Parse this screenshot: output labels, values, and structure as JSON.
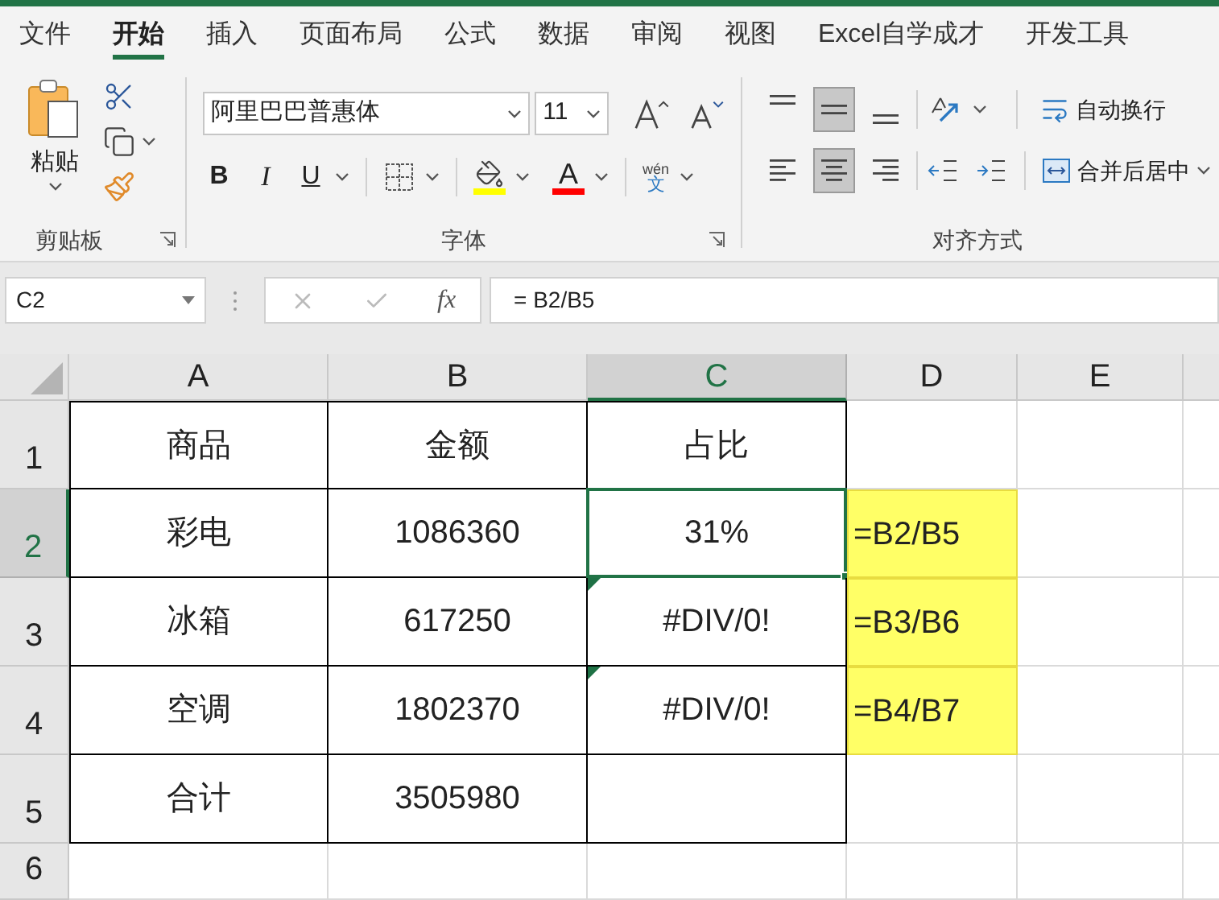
{
  "menu_tabs": [
    {
      "label": "文件",
      "selected": false
    },
    {
      "label": "开始",
      "selected": true
    },
    {
      "label": "插入",
      "selected": false
    },
    {
      "label": "页面布局",
      "selected": false
    },
    {
      "label": "公式",
      "selected": false
    },
    {
      "label": "数据",
      "selected": false
    },
    {
      "label": "审阅",
      "selected": false
    },
    {
      "label": "视图",
      "selected": false
    },
    {
      "label": "Excel自学成才",
      "selected": false
    },
    {
      "label": "开发工具",
      "selected": false
    }
  ],
  "clipboard": {
    "paste_label": "粘贴",
    "group_label": "剪贴板"
  },
  "font": {
    "name": "阿里巴巴普惠体",
    "size": "11",
    "bold": "B",
    "italic": "I",
    "underline": "U",
    "font_color_glyph": "A",
    "phonetic_top": "wén",
    "phonetic_bottom": "文",
    "group_label": "字体"
  },
  "alignment": {
    "vertical": [
      {
        "selected": false
      },
      {
        "selected": true
      },
      {
        "selected": false
      }
    ],
    "horizontal": [
      {
        "selected": false
      },
      {
        "selected": true
      },
      {
        "selected": false
      }
    ],
    "wrap_text": "自动换行",
    "merge_center": "合并后居中",
    "group_label": "对齐方式"
  },
  "formula_bar": {
    "name_box": "C2",
    "fx": "fx",
    "formula": "= B2/B5"
  },
  "columns": [
    {
      "label": "A",
      "selected": false
    },
    {
      "label": "B",
      "selected": false
    },
    {
      "label": "C",
      "selected": true
    },
    {
      "label": "D",
      "selected": false
    },
    {
      "label": "E",
      "selected": false
    }
  ],
  "rows": [
    {
      "label": "1",
      "selected": false,
      "cells": [
        {
          "kind": "table",
          "text": "商品",
          "active": false,
          "error_flag": false
        },
        {
          "kind": "table",
          "text": "金额",
          "active": false,
          "error_flag": false
        },
        {
          "kind": "table",
          "text": "占比",
          "active": false,
          "error_flag": false
        },
        {
          "kind": "plain",
          "active": false,
          "error_flag": false
        },
        {
          "kind": "plain",
          "active": false,
          "error_flag": false
        }
      ]
    },
    {
      "label": "2",
      "selected": true,
      "cells": [
        {
          "kind": "table",
          "text": "彩电",
          "active": false,
          "error_flag": false
        },
        {
          "kind": "table",
          "text": "1086360",
          "active": false,
          "error_flag": false
        },
        {
          "kind": "table",
          "text": "31%",
          "active": true,
          "error_flag": false
        },
        {
          "kind": "highlight",
          "text": "=B2/B5",
          "active": false,
          "error_flag": false
        },
        {
          "kind": "plain",
          "active": false,
          "error_flag": false
        }
      ]
    },
    {
      "label": "3",
      "selected": false,
      "cells": [
        {
          "kind": "table",
          "text": "冰箱",
          "active": false,
          "error_flag": false
        },
        {
          "kind": "table",
          "text": "617250",
          "active": false,
          "error_flag": false
        },
        {
          "kind": "table",
          "text": "#DIV/0!",
          "active": false,
          "error_flag": true
        },
        {
          "kind": "highlight",
          "text": "=B3/B6",
          "active": false,
          "error_flag": false
        },
        {
          "kind": "plain",
          "active": false,
          "error_flag": false
        }
      ]
    },
    {
      "label": "4",
      "selected": false,
      "cells": [
        {
          "kind": "table",
          "text": "空调",
          "active": false,
          "error_flag": false
        },
        {
          "kind": "table",
          "text": "1802370",
          "active": false,
          "error_flag": false
        },
        {
          "kind": "table",
          "text": "#DIV/0!",
          "active": false,
          "error_flag": true
        },
        {
          "kind": "highlight",
          "text": "=B4/B7",
          "active": false,
          "error_flag": false
        },
        {
          "kind": "plain",
          "active": false,
          "error_flag": false
        }
      ]
    },
    {
      "label": "5",
      "selected": false,
      "cells": [
        {
          "kind": "table",
          "text": "合计",
          "active": false,
          "error_flag": false
        },
        {
          "kind": "table",
          "text": "3505980",
          "active": false,
          "error_flag": false
        },
        {
          "kind": "table",
          "active": false,
          "error_flag": false
        },
        {
          "kind": "plain",
          "active": false,
          "error_flag": false
        },
        {
          "kind": "plain",
          "active": false,
          "error_flag": false
        }
      ]
    },
    {
      "label": "6",
      "selected": false,
      "cells": [
        {
          "kind": "plain",
          "active": false,
          "error_flag": false
        },
        {
          "kind": "plain",
          "active": false,
          "error_flag": false
        },
        {
          "kind": "plain",
          "active": false,
          "error_flag": false
        },
        {
          "kind": "plain",
          "active": false,
          "error_flag": false
        },
        {
          "kind": "plain",
          "active": false,
          "error_flag": false
        }
      ]
    }
  ]
}
